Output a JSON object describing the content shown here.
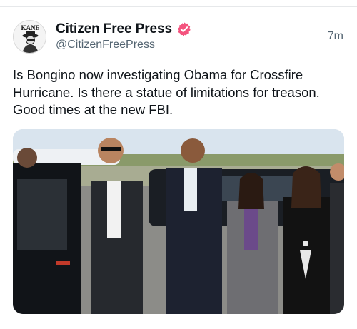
{
  "tweet": {
    "display_name": "Citizen Free Press",
    "handle": "@CitizenFreePress",
    "timestamp": "7m",
    "text": "Is Bongino now investigating Obama for Crossfire Hurricane. Is there a statue of limitations for treason. Good times at the new FBI.",
    "avatar_text": "KANE",
    "verified_color": "#f4537e"
  },
  "media": {
    "description_icon": "photo"
  }
}
